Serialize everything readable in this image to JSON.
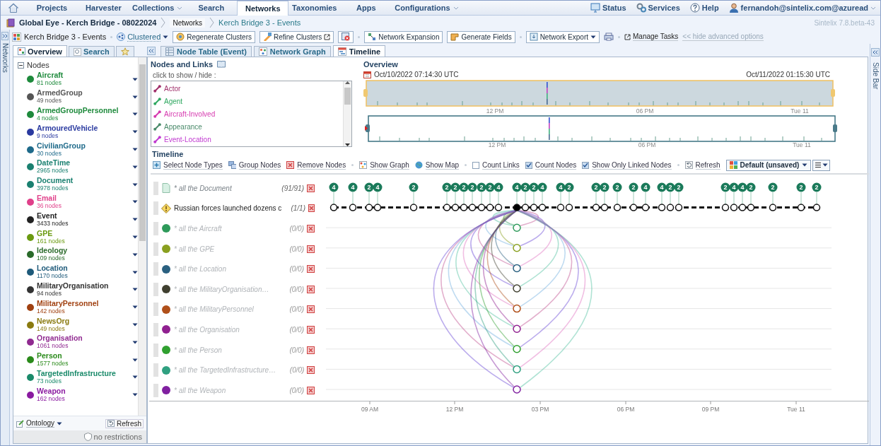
{
  "nav": {
    "tabs": [
      {
        "label": "Projects",
        "selected": false,
        "dropdown": false
      },
      {
        "label": "Harvester",
        "selected": false,
        "dropdown": false
      },
      {
        "label": "Collections",
        "selected": false,
        "dropdown": true
      },
      {
        "label": "Search",
        "selected": false,
        "dropdown": false
      },
      {
        "label": "Networks",
        "selected": true,
        "dropdown": false
      },
      {
        "label": "Taxonomies",
        "selected": false,
        "dropdown": false
      },
      {
        "label": "Apps",
        "selected": false,
        "dropdown": false
      },
      {
        "label": "Configurations",
        "selected": false,
        "dropdown": true
      }
    ],
    "links": [
      {
        "label": "Status",
        "dropdown": false
      },
      {
        "label": "Services",
        "dropdown": false
      },
      {
        "label": "Help",
        "dropdown": false
      },
      {
        "label": "fernandoh@sintelix.com@azuread",
        "dropdown": true
      }
    ]
  },
  "breadcrumb": [
    "Global Eye - Kerch Bridge - 08022024",
    "Networks",
    "Kerch Bridge 3 - Events"
  ],
  "version": "Sintelix 7.8.beta-43",
  "toolbar": {
    "network": "Kerch Bridge 3 - Events",
    "layout": "Clustered",
    "buttons": [
      {
        "label": "Regenerate Clusters",
        "dropdown": false
      },
      {
        "label": "Refine Clusters",
        "dropdown": false
      },
      {
        "label": "Network Expansion",
        "dropdown": false
      },
      {
        "label": "Generate Fields",
        "dropdown": false
      },
      {
        "label": "Network Export",
        "dropdown": true
      }
    ],
    "links": [
      "Manage Tasks",
      "<< hide advanced options"
    ]
  },
  "left_strip": "Networks",
  "right_strip": "Side Bar",
  "sidebar": {
    "tabs": [
      {
        "label": "Overview",
        "selected": true
      },
      {
        "label": "Search",
        "selected": false
      }
    ],
    "tree_title": "Nodes",
    "node_types": [
      {
        "name": "Aircraft",
        "count": "81 nodes",
        "color": "#1e8a3c"
      },
      {
        "name": "ArmedGroup",
        "count": "49 nodes",
        "color": "#555555"
      },
      {
        "name": "ArmedGroupPersonnel",
        "count": "4 nodes",
        "color": "#1e8a3c"
      },
      {
        "name": "ArmouredVehicle",
        "count": "9 nodes",
        "color": "#2a3aa0"
      },
      {
        "name": "CivilianGroup",
        "count": "30 nodes",
        "color": "#1e6a8a"
      },
      {
        "name": "DateTime",
        "count": "2965 nodes",
        "color": "#1a8070"
      },
      {
        "name": "Document",
        "count": "3978 nodes",
        "color": "#1a8070"
      },
      {
        "name": "Email",
        "count": "36 nodes",
        "color": "#e0408a"
      },
      {
        "name": "Event",
        "count": "3433 nodes",
        "color": "#222222"
      },
      {
        "name": "GPE",
        "count": "161 nodes",
        "color": "#6a9a10"
      },
      {
        "name": "Ideology",
        "count": "109 nodes",
        "color": "#2a6a2a"
      },
      {
        "name": "Location",
        "count": "1170 nodes",
        "color": "#1e5a7a"
      },
      {
        "name": "MilitaryOrganisation",
        "count": "94 nodes",
        "color": "#333333"
      },
      {
        "name": "MilitaryPersonnel",
        "count": "142 nodes",
        "color": "#a04010"
      },
      {
        "name": "NewsOrg",
        "count": "149 nodes",
        "color": "#8a7a10"
      },
      {
        "name": "Organisation",
        "count": "1061 nodes",
        "color": "#902a90"
      },
      {
        "name": "Person",
        "count": "1577 nodes",
        "color": "#2a8a1a"
      },
      {
        "name": "TargetedInfrastructure",
        "count": "73 nodes",
        "color": "#1a8a6a"
      },
      {
        "name": "Weapon",
        "count": "162 nodes",
        "color": "#8a1aa0"
      }
    ],
    "ontology": "Ontology",
    "refresh": "Refresh",
    "restrictions": "no restrictions"
  },
  "view_tabs": [
    {
      "label": "Node Table (Event)",
      "selected": false
    },
    {
      "label": "Network Graph",
      "selected": false
    },
    {
      "label": "Timeline",
      "selected": true
    }
  ],
  "nodes_and_links": {
    "title": "Nodes and Links",
    "hint": "click to show / hide :",
    "links": [
      {
        "label": "Actor",
        "color": "#a0306b"
      },
      {
        "label": "Agent",
        "color": "#2fa860"
      },
      {
        "label": "Aircraft-Involved",
        "color": "#d63aaf"
      },
      {
        "label": "Appearance",
        "color": "#4a8a6a"
      },
      {
        "label": "Event-Location",
        "color": "#c03ad0"
      }
    ]
  },
  "overview": {
    "title": "Overview",
    "start": "Oct/10/2022 07:14:30 UTC",
    "end": "Oct/11/2022 01:15:30 UTC",
    "range_ticks": [
      "12 PM",
      "06 PM",
      "Tue 11"
    ],
    "detail_ticks": [
      "12 PM",
      "06 PM",
      "Tue 11"
    ]
  },
  "timeline": {
    "title": "Timeline",
    "tool_groups": [
      [
        {
          "kind": "button",
          "label": "Select Node Types"
        },
        {
          "kind": "button",
          "label": "Group Nodes"
        },
        {
          "kind": "button",
          "label": "Remove Nodes"
        }
      ],
      [
        {
          "kind": "button",
          "label": "Show Graph"
        },
        {
          "kind": "button",
          "label": "Show Map"
        }
      ],
      [
        {
          "kind": "checkbox",
          "label": "Count Links",
          "checked": false
        },
        {
          "kind": "checkbox",
          "label": "Count Nodes",
          "checked": true
        },
        {
          "kind": "checkbox",
          "label": "Show Only Linked Nodes",
          "checked": true
        }
      ],
      [
        {
          "kind": "button",
          "label": "Refresh"
        }
      ]
    ],
    "preset": "Default (unsaved)",
    "rows": [
      {
        "kind": "document",
        "label": "* all the Document",
        "count": "(91/91)"
      },
      {
        "kind": "event",
        "label": "Russian forces launched dozens c",
        "count": "(1/1)"
      },
      {
        "kind": "type",
        "label": "* all the Aircraft",
        "count": "(0/0)",
        "color": "#2e9a5a"
      },
      {
        "kind": "type",
        "label": "* all the GPE",
        "count": "(0/0)",
        "color": "#8aa020"
      },
      {
        "kind": "type",
        "label": "* all the Location",
        "count": "(0/0)",
        "color": "#2a6080"
      },
      {
        "kind": "type",
        "label": "* all the MilitaryOrganisation…",
        "count": "(0/0)",
        "color": "#404030"
      },
      {
        "kind": "type",
        "label": "* all the MilitaryPersonnel",
        "count": "(0/0)",
        "color": "#b0501a"
      },
      {
        "kind": "type",
        "label": "* all the Organisation",
        "count": "(0/0)",
        "color": "#902090"
      },
      {
        "kind": "type",
        "label": "* all the Person",
        "count": "(0/0)",
        "color": "#30a030"
      },
      {
        "kind": "type",
        "label": "* all the TargetedInfrastructure…",
        "count": "(0/0)",
        "color": "#30a080"
      },
      {
        "kind": "type",
        "label": "* all the Weapon",
        "count": "(0/0)",
        "color": "#8020a0"
      }
    ],
    "events": [
      {
        "count": "4",
        "selected": false
      },
      {
        "count": "4",
        "selected": false
      },
      {
        "count": "2",
        "selected": false
      },
      {
        "count": "4",
        "selected": false
      },
      {
        "count": "2",
        "selected": false
      },
      {
        "count": "2",
        "selected": false
      },
      {
        "count": "2",
        "selected": false
      },
      {
        "count": "2",
        "selected": false
      },
      {
        "count": "2",
        "selected": false
      },
      {
        "count": "2",
        "selected": false
      },
      {
        "count": "2",
        "selected": false
      },
      {
        "count": "4",
        "selected": false
      },
      {
        "count": "4",
        "selected": true
      },
      {
        "count": "2",
        "selected": false
      },
      {
        "count": "2",
        "selected": false
      },
      {
        "count": "4",
        "selected": false
      },
      {
        "count": "4",
        "selected": false
      },
      {
        "count": "2",
        "selected": false
      },
      {
        "count": "2",
        "selected": false
      },
      {
        "count": "2",
        "selected": false
      },
      {
        "count": "2",
        "selected": false
      },
      {
        "count": "2",
        "selected": false
      },
      {
        "count": "4",
        "selected": false
      },
      {
        "count": "4",
        "selected": false
      },
      {
        "count": "2",
        "selected": false
      },
      {
        "count": "2",
        "selected": false
      },
      {
        "count": "2",
        "selected": false
      },
      {
        "count": "4",
        "selected": false
      },
      {
        "count": "4",
        "selected": false
      },
      {
        "count": "2",
        "selected": false
      },
      {
        "count": "2",
        "selected": false
      },
      {
        "count": "2",
        "selected": false
      },
      {
        "count": "2",
        "selected": false
      }
    ],
    "axis": [
      "09 AM",
      "12 PM",
      "03 PM",
      "06 PM",
      "09 PM",
      "Tue 11"
    ]
  }
}
